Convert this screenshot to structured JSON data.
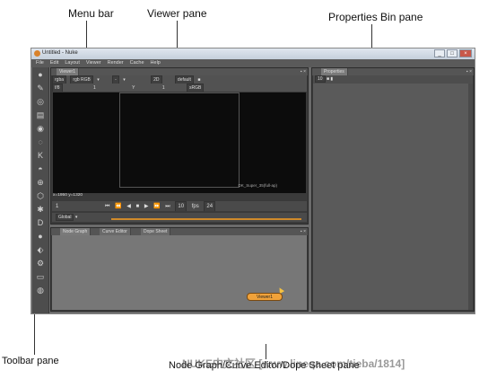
{
  "annotations": {
    "menu_bar": "Menu bar",
    "viewer_pane": "Viewer pane",
    "properties_bin_pane": "Properties Bin pane",
    "toolbar_pane": "Toolbar pane",
    "node_graph_pane": "Node Graph/Curve Editor/Dope Sheet pane",
    "watermark": "NUKE中文社区 [www.lineqa.com/tieba/1814]"
  },
  "window": {
    "title": "Untitled - Nuke",
    "controls": [
      "_",
      "□",
      "×"
    ]
  },
  "menubar": [
    "File",
    "Edit",
    "Layout",
    "Viewer",
    "Render",
    "Cache",
    "Help"
  ],
  "toolbar": {
    "icons": [
      "●",
      "✎",
      "◎",
      "▤",
      "◉",
      "◌",
      "K",
      "◓",
      "⊕",
      "⬡",
      "✱",
      "D",
      "●",
      "⬖",
      "⚙",
      "▭",
      "◍"
    ]
  },
  "viewer": {
    "tab": "Viewer1",
    "row1": [
      "rgba",
      "rgb RGB",
      "▾",
      "-",
      "▾",
      "2D",
      "default",
      "■"
    ],
    "row2": [
      "f/8",
      "1",
      "Y",
      "1",
      "sRGB"
    ],
    "format_label": "DK_Super_35(full-ap)",
    "coords": "x=1950 y=1320",
    "transport": [
      "1",
      "⏮",
      "⏪",
      "◀",
      "■",
      "▶",
      "⏩",
      "⏭",
      "10",
      "fps",
      "24"
    ],
    "timeline": [
      "Global",
      "▾"
    ]
  },
  "nodegraph": {
    "tabs": [
      "Node Graph",
      "Curve Editor",
      "Dope Sheet"
    ],
    "node_label": "Viewer1"
  },
  "properties": {
    "tab": "Properties",
    "value": "10"
  }
}
